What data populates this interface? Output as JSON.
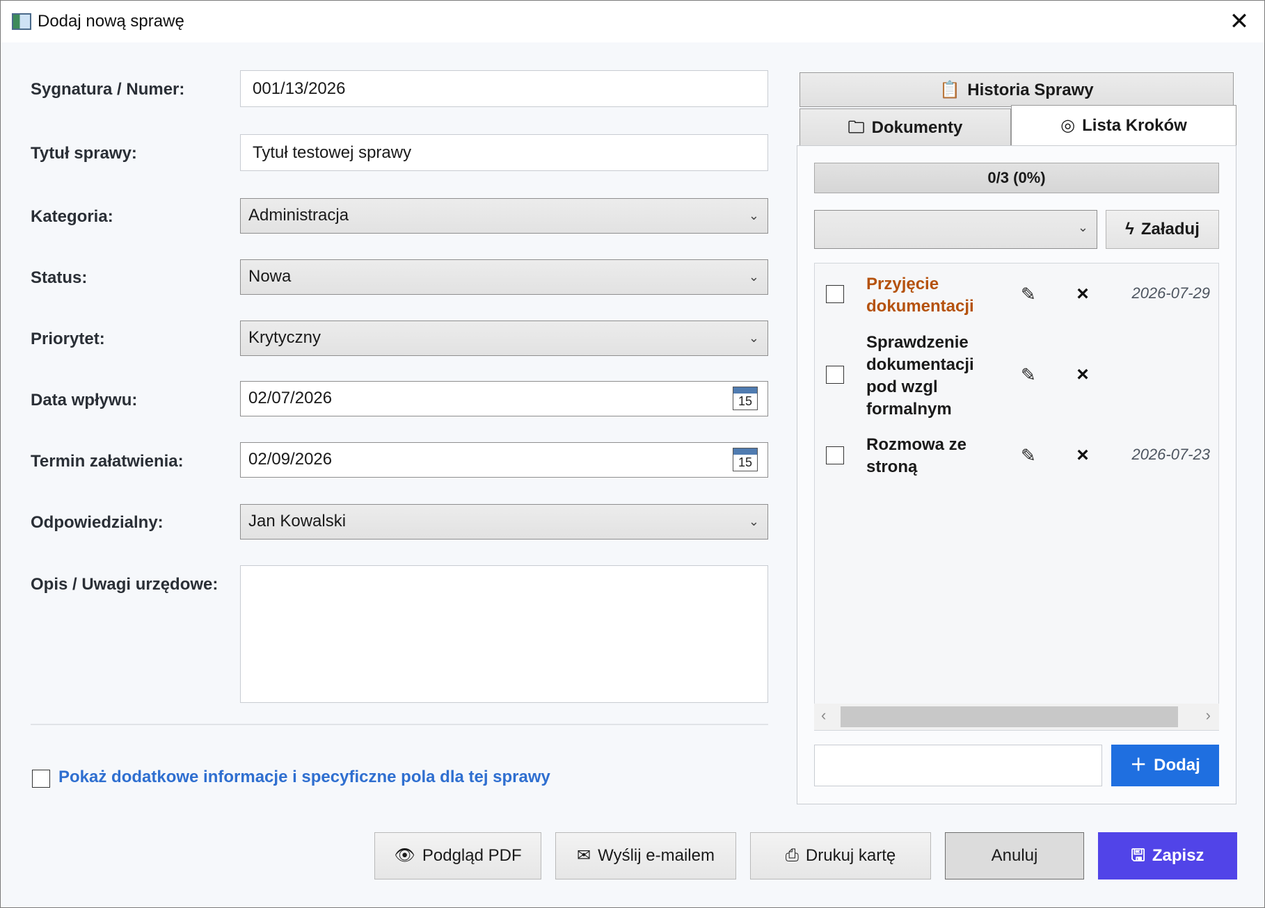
{
  "window": {
    "title": "Dodaj nową sprawę",
    "close_glyph": "✕"
  },
  "form": {
    "signature": {
      "label": "Sygnatura / Numer:",
      "value": "001/13/2026"
    },
    "case_title": {
      "label": "Tytuł sprawy:",
      "value": "Tytuł testowej sprawy"
    },
    "category": {
      "label": "Kategoria:",
      "value": "Administracja"
    },
    "status": {
      "label": "Status:",
      "value": "Nowa"
    },
    "priority": {
      "label": "Priorytet:",
      "value": "Krytyczny"
    },
    "date_received": {
      "label": "Data wpływu:",
      "value": "02/07/2026"
    },
    "deadline": {
      "label": "Termin załatwienia:",
      "value": "02/09/2026"
    },
    "responsible": {
      "label": "Odpowiedzialny:",
      "value": "Jan Kowalski"
    },
    "description": {
      "label": "Opis / Uwagi urzędowe:",
      "value": ""
    },
    "calendar_day": "15",
    "extra_fields_label": "Pokaż dodatkowe informacje i specyficzne pola dla tej sprawy"
  },
  "tabs": {
    "history": "Historia Sprawy",
    "documents": "Dokumenty",
    "steps": "Lista Kroków",
    "active": "steps"
  },
  "steps_panel": {
    "progress_text": "0/3 (0%)",
    "load_button": "Załaduj",
    "add_button": "Dodaj",
    "steps": [
      {
        "name": "Przyjęcie dokumentacji",
        "date": "2026-07-29",
        "highlighted": true,
        "checked": false
      },
      {
        "name": "Sprawdzenie dokumentacji pod wzgl formalnym",
        "date": "",
        "highlighted": false,
        "checked": false
      },
      {
        "name": "Rozmowa ze stroną",
        "date": "2026-07-23",
        "highlighted": false,
        "checked": false
      }
    ]
  },
  "buttons": {
    "pdf_preview": "Podgląd PDF",
    "send_email": "Wyślij e-mailem",
    "print_card": "Drukuj kartę",
    "cancel": "Anuluj",
    "save": "Zapisz"
  },
  "colors": {
    "accent_blue": "#1f6fe0",
    "save_purple": "#5144e8",
    "highlight_step": "#b5520e",
    "link_blue": "#2f6fd0"
  },
  "icons": {
    "history": "history-icon",
    "documents": "folder-icon",
    "steps": "target-icon",
    "load": "lightning-icon",
    "edit": "edit-icon",
    "delete": "close-icon",
    "add": "plus-icon",
    "pdf": "eye-icon",
    "email": "envelope-icon",
    "print": "printer-icon",
    "save": "floppy-icon",
    "calendar": "calendar-icon"
  }
}
